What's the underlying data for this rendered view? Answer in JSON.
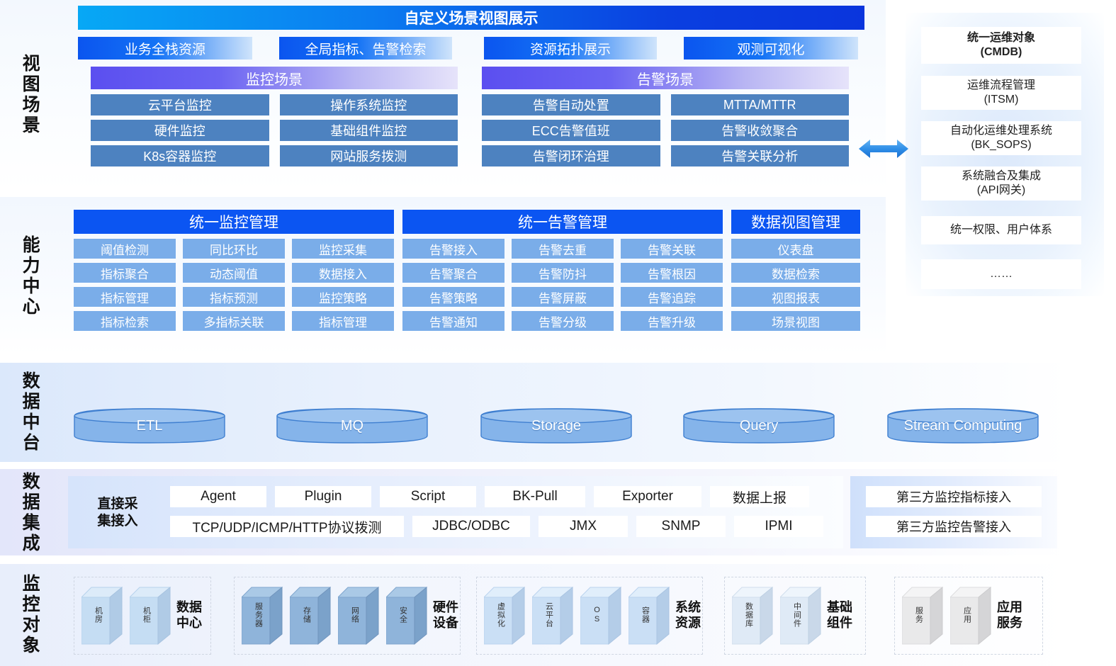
{
  "rows": [
    {
      "label": "视图场景"
    },
    {
      "label": "能力中心"
    },
    {
      "label": "数据中台"
    },
    {
      "label": "数据集成"
    },
    {
      "label": "监控对象"
    }
  ],
  "view_scene": {
    "banner": "自定义场景视图展示",
    "tabs": [
      "业务全栈资源",
      "全局指标、告警检索",
      "资源拓扑展示",
      "观测可视化"
    ],
    "panels": [
      {
        "title": "监控场景",
        "columns": [
          [
            "云平台监控",
            "硬件监控",
            "K8s容器监控"
          ],
          [
            "操作系统监控",
            "基础组件监控",
            "网站服务拨测"
          ]
        ]
      },
      {
        "title": "告警场景",
        "columns": [
          [
            "告警自动处置",
            "ECC告警值班",
            "告警闭环治理"
          ],
          [
            "MTTA/MTTR",
            "告警收敛聚合",
            "告警关联分析"
          ]
        ]
      }
    ]
  },
  "cmdb": {
    "items": [
      {
        "lines": [
          "统一运维对象",
          "(CMDB)"
        ],
        "bold": true
      },
      {
        "lines": [
          "运维流程管理",
          "(ITSM)"
        ],
        "bold": false
      },
      {
        "lines": [
          "自动化运维处理系统",
          "(BK_SOPS)"
        ],
        "bold": false
      },
      {
        "lines": [
          "系统融合及集成",
          "(API网关)"
        ],
        "bold": false
      },
      {
        "lines": [
          "统一权限、用户体系"
        ],
        "bold": false
      },
      {
        "lines": [
          "……"
        ],
        "bold": false
      }
    ]
  },
  "capability": {
    "groups": [
      {
        "title": "统一监控管理",
        "columns": [
          [
            "阈值检测",
            "指标聚合",
            "指标管理",
            "指标检索"
          ],
          [
            "同比环比",
            "动态阈值",
            "指标预测",
            "多指标关联"
          ],
          [
            "监控采集",
            "数据接入",
            "监控策略",
            "指标管理"
          ]
        ]
      },
      {
        "title": "统一告警管理",
        "columns": [
          [
            "告警接入",
            "告警聚合",
            "告警策略",
            "告警通知"
          ],
          [
            "告警去重",
            "告警防抖",
            "告警屏蔽",
            "告警分级"
          ],
          [
            "告警关联",
            "告警根因",
            "告警追踪",
            "告警升级"
          ]
        ]
      },
      {
        "title": "数据视图管理",
        "columns": [
          [
            "仪表盘",
            "数据检索",
            "视图报表",
            "场景视图"
          ]
        ]
      }
    ]
  },
  "data_platform": {
    "items": [
      "ETL",
      "MQ",
      "Storage",
      "Query",
      "Stream Computing"
    ]
  },
  "data_integration": {
    "direct_label": "直接采\n集接入",
    "row1": [
      "Agent",
      "Plugin",
      "Script",
      "BK-Pull",
      "Exporter",
      "数据上报"
    ],
    "row2": [
      "TCP/UDP/ICMP/HTTP协议拨测",
      "JDBC/ODBC",
      "JMX",
      "SNMP",
      "IPMI"
    ],
    "third_party": [
      "第三方监控指标接入",
      "第三方监控告警接入"
    ]
  },
  "monitor_objects": {
    "groups": [
      {
        "title": "数据\n中心",
        "tone": "light",
        "cubes": [
          "机房",
          "机柜"
        ]
      },
      {
        "title": "硬件\n设备",
        "tone": "dark",
        "cubes": [
          "服务器",
          "存储",
          "网络",
          "安全"
        ]
      },
      {
        "title": "系统\n资源",
        "tone": "mid",
        "cubes": [
          "虚拟化",
          "云平台",
          "OS",
          "容器"
        ]
      },
      {
        "title": "基础\n组件",
        "tone": "pale",
        "cubes": [
          "数据库",
          "中间件"
        ]
      },
      {
        "title": "应用\n服务",
        "tone": "gray",
        "cubes": [
          "服务",
          "应用"
        ]
      }
    ]
  },
  "colors": {
    "banner_start": "#07a8f5",
    "banner_end": "#0a35dd",
    "tab_start": "#0b55ef",
    "scene_head_start": "#5b4ff0",
    "scene_cell": "#4d82c0",
    "cap_head": "#0b55f2",
    "cap_cell": "#7aade9",
    "cylinder": "#7fb2e8",
    "arrow": "#2f8fe8"
  }
}
